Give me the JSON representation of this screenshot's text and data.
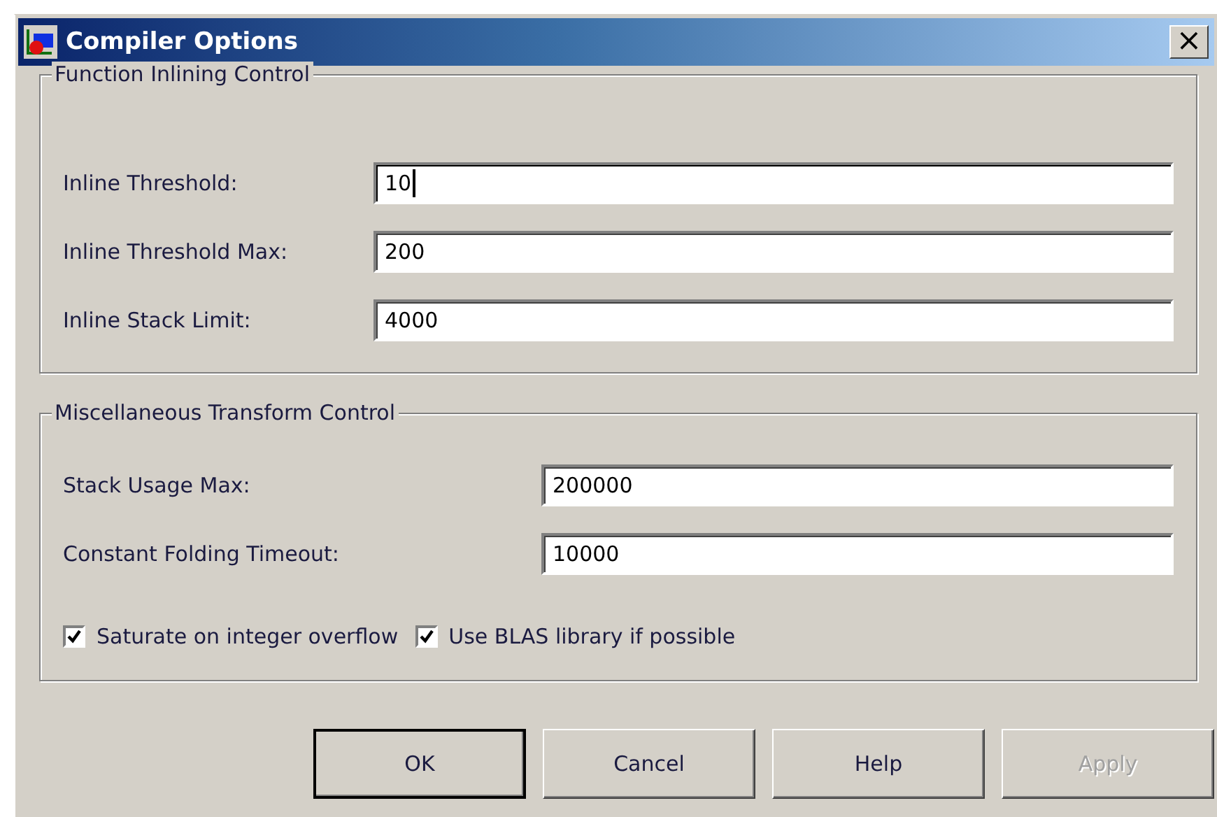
{
  "window": {
    "title": "Compiler Options",
    "close": "×"
  },
  "groups": [
    {
      "title": "Function Inlining Control",
      "fields": [
        {
          "label": "Inline Threshold:",
          "value": "10",
          "focused": true
        },
        {
          "label": "Inline Threshold Max:",
          "value": "200",
          "focused": false
        },
        {
          "label": "Inline Stack Limit:",
          "value": "4000",
          "focused": false
        }
      ]
    },
    {
      "title": "Miscellaneous Transform Control",
      "fields": [
        {
          "label": "Stack Usage Max:",
          "value": "200000",
          "focused": false
        },
        {
          "label": "Constant Folding Timeout:",
          "value": "10000",
          "focused": false
        }
      ],
      "checkboxes": [
        {
          "label": "Saturate on integer overflow",
          "checked": true
        },
        {
          "label": "Use BLAS library if possible",
          "checked": true
        }
      ]
    }
  ],
  "buttons": [
    {
      "label": "OK",
      "default": true,
      "disabled": false
    },
    {
      "label": "Cancel",
      "default": false,
      "disabled": false
    },
    {
      "label": "Help",
      "default": false,
      "disabled": false
    },
    {
      "label": "Apply",
      "default": false,
      "disabled": true
    }
  ]
}
